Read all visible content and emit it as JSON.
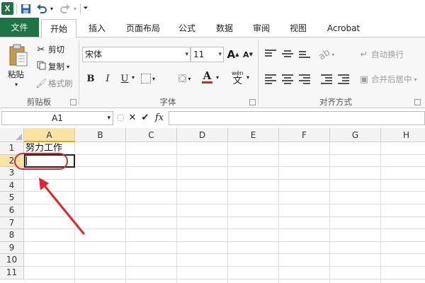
{
  "quick_access": {
    "app_icon": "excel-logo",
    "app_letter": "X",
    "save": "save-icon",
    "undo": "undo-icon",
    "redo": "redo-icon",
    "customize": "customize-icon"
  },
  "tabs": [
    {
      "label": "文件"
    },
    {
      "label": "开始"
    },
    {
      "label": "插入"
    },
    {
      "label": "页面布局"
    },
    {
      "label": "公式"
    },
    {
      "label": "数据"
    },
    {
      "label": "审阅"
    },
    {
      "label": "视图"
    },
    {
      "label": "Acrobat"
    }
  ],
  "ribbon": {
    "clipboard": {
      "paste": "粘贴",
      "cut": "剪切",
      "copy": "复制",
      "format_painter": "格式刷",
      "group": "剪贴板"
    },
    "font": {
      "name": "宋体",
      "size": "11",
      "grow": "A",
      "shrink": "A",
      "bold": "B",
      "italic": "I",
      "underline": "U",
      "font_color": "A",
      "phonetic": "wén",
      "group": "字体",
      "font_color_value": "#e02020"
    },
    "alignment": {
      "wrap": "自动换行",
      "merge": "合并后居中",
      "group": "对齐方式"
    }
  },
  "formula_bar": {
    "name_box": "A1",
    "cancel": "✕",
    "enter": "✔",
    "fx": "fx",
    "value": ""
  },
  "grid": {
    "columns": [
      "A",
      "B",
      "C",
      "D",
      "E",
      "F",
      "G",
      "H"
    ],
    "rows": [
      "1",
      "2",
      "3",
      "4",
      "5",
      "6",
      "7",
      "8",
      "9",
      "10",
      "11"
    ],
    "active_column": "A",
    "cells": {
      "A1": "努力工作",
      "A2": ""
    }
  },
  "annotation": {
    "color": "#e5232d"
  }
}
